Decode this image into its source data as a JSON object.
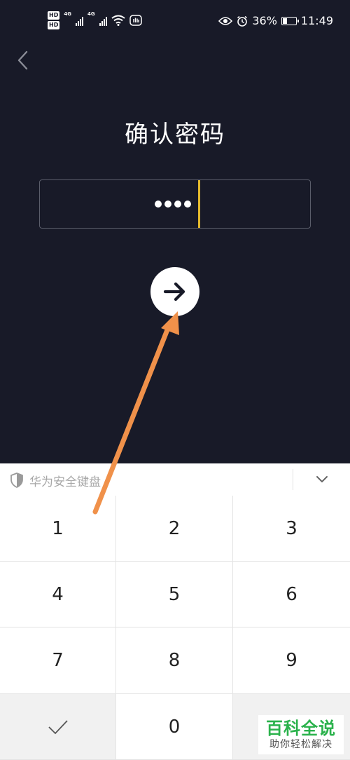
{
  "status_bar": {
    "hd_badges": [
      "HD",
      "HD"
    ],
    "network_1": "4G",
    "network_2": "4G",
    "battery_percent": "36%",
    "battery_level": 0.36,
    "time": "11:49",
    "icons": [
      "eye-icon",
      "alarm-icon",
      "wifi-icon",
      "hand-icon"
    ]
  },
  "header": {
    "back_icon": "chevron-left-icon"
  },
  "page": {
    "title": "确认密码"
  },
  "password_field": {
    "masked_digits": 4,
    "caret_color": "#e3b92d"
  },
  "submit": {
    "icon": "arrow-right-icon"
  },
  "keyboard": {
    "title": "华为安全键盘",
    "shield_icon": "shield-icon",
    "collapse_icon": "chevron-down-icon",
    "keys": [
      "1",
      "2",
      "3",
      "4",
      "5",
      "6",
      "7",
      "8",
      "9",
      "",
      "0",
      ""
    ],
    "confirm_icon": "checkmark-icon"
  },
  "annotation": {
    "color": "#f0914a"
  },
  "watermark": {
    "brand": "百科全说",
    "tagline": "助你轻松解决"
  },
  "colors": {
    "background": "#181a28",
    "keyboard_bg": "#ffffff"
  }
}
